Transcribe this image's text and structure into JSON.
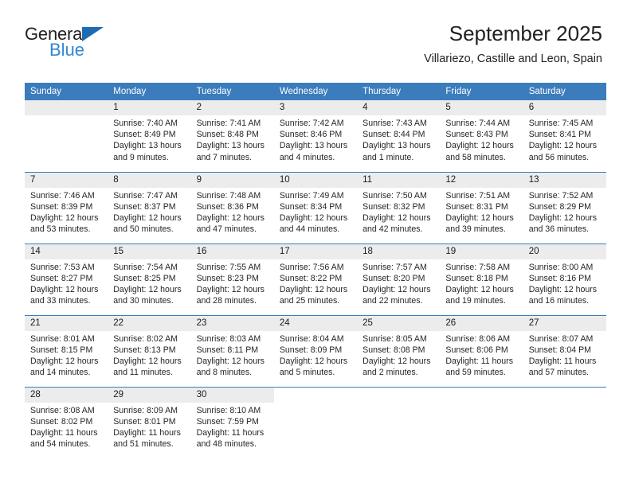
{
  "brand": {
    "name_top": "General",
    "name_bottom": "Blue",
    "accent_color": "#2f88d4",
    "triangle_color": "#1b6cb5"
  },
  "header": {
    "title": "September 2025",
    "subtitle": "Villariezo, Castille and Leon, Spain",
    "header_bg": "#3b7cbd",
    "daynum_bg": "#ececec"
  },
  "weekday_headers": [
    "Sunday",
    "Monday",
    "Tuesday",
    "Wednesday",
    "Thursday",
    "Friday",
    "Saturday"
  ],
  "weeks": [
    [
      {
        "day": "",
        "lines": []
      },
      {
        "day": "1",
        "lines": [
          "Sunrise: 7:40 AM",
          "Sunset: 8:49 PM",
          "Daylight: 13 hours",
          "and 9 minutes."
        ]
      },
      {
        "day": "2",
        "lines": [
          "Sunrise: 7:41 AM",
          "Sunset: 8:48 PM",
          "Daylight: 13 hours",
          "and 7 minutes."
        ]
      },
      {
        "day": "3",
        "lines": [
          "Sunrise: 7:42 AM",
          "Sunset: 8:46 PM",
          "Daylight: 13 hours",
          "and 4 minutes."
        ]
      },
      {
        "day": "4",
        "lines": [
          "Sunrise: 7:43 AM",
          "Sunset: 8:44 PM",
          "Daylight: 13 hours",
          "and 1 minute."
        ]
      },
      {
        "day": "5",
        "lines": [
          "Sunrise: 7:44 AM",
          "Sunset: 8:43 PM",
          "Daylight: 12 hours",
          "and 58 minutes."
        ]
      },
      {
        "day": "6",
        "lines": [
          "Sunrise: 7:45 AM",
          "Sunset: 8:41 PM",
          "Daylight: 12 hours",
          "and 56 minutes."
        ]
      }
    ],
    [
      {
        "day": "7",
        "lines": [
          "Sunrise: 7:46 AM",
          "Sunset: 8:39 PM",
          "Daylight: 12 hours",
          "and 53 minutes."
        ]
      },
      {
        "day": "8",
        "lines": [
          "Sunrise: 7:47 AM",
          "Sunset: 8:37 PM",
          "Daylight: 12 hours",
          "and 50 minutes."
        ]
      },
      {
        "day": "9",
        "lines": [
          "Sunrise: 7:48 AM",
          "Sunset: 8:36 PM",
          "Daylight: 12 hours",
          "and 47 minutes."
        ]
      },
      {
        "day": "10",
        "lines": [
          "Sunrise: 7:49 AM",
          "Sunset: 8:34 PM",
          "Daylight: 12 hours",
          "and 44 minutes."
        ]
      },
      {
        "day": "11",
        "lines": [
          "Sunrise: 7:50 AM",
          "Sunset: 8:32 PM",
          "Daylight: 12 hours",
          "and 42 minutes."
        ]
      },
      {
        "day": "12",
        "lines": [
          "Sunrise: 7:51 AM",
          "Sunset: 8:31 PM",
          "Daylight: 12 hours",
          "and 39 minutes."
        ]
      },
      {
        "day": "13",
        "lines": [
          "Sunrise: 7:52 AM",
          "Sunset: 8:29 PM",
          "Daylight: 12 hours",
          "and 36 minutes."
        ]
      }
    ],
    [
      {
        "day": "14",
        "lines": [
          "Sunrise: 7:53 AM",
          "Sunset: 8:27 PM",
          "Daylight: 12 hours",
          "and 33 minutes."
        ]
      },
      {
        "day": "15",
        "lines": [
          "Sunrise: 7:54 AM",
          "Sunset: 8:25 PM",
          "Daylight: 12 hours",
          "and 30 minutes."
        ]
      },
      {
        "day": "16",
        "lines": [
          "Sunrise: 7:55 AM",
          "Sunset: 8:23 PM",
          "Daylight: 12 hours",
          "and 28 minutes."
        ]
      },
      {
        "day": "17",
        "lines": [
          "Sunrise: 7:56 AM",
          "Sunset: 8:22 PM",
          "Daylight: 12 hours",
          "and 25 minutes."
        ]
      },
      {
        "day": "18",
        "lines": [
          "Sunrise: 7:57 AM",
          "Sunset: 8:20 PM",
          "Daylight: 12 hours",
          "and 22 minutes."
        ]
      },
      {
        "day": "19",
        "lines": [
          "Sunrise: 7:58 AM",
          "Sunset: 8:18 PM",
          "Daylight: 12 hours",
          "and 19 minutes."
        ]
      },
      {
        "day": "20",
        "lines": [
          "Sunrise: 8:00 AM",
          "Sunset: 8:16 PM",
          "Daylight: 12 hours",
          "and 16 minutes."
        ]
      }
    ],
    [
      {
        "day": "21",
        "lines": [
          "Sunrise: 8:01 AM",
          "Sunset: 8:15 PM",
          "Daylight: 12 hours",
          "and 14 minutes."
        ]
      },
      {
        "day": "22",
        "lines": [
          "Sunrise: 8:02 AM",
          "Sunset: 8:13 PM",
          "Daylight: 12 hours",
          "and 11 minutes."
        ]
      },
      {
        "day": "23",
        "lines": [
          "Sunrise: 8:03 AM",
          "Sunset: 8:11 PM",
          "Daylight: 12 hours",
          "and 8 minutes."
        ]
      },
      {
        "day": "24",
        "lines": [
          "Sunrise: 8:04 AM",
          "Sunset: 8:09 PM",
          "Daylight: 12 hours",
          "and 5 minutes."
        ]
      },
      {
        "day": "25",
        "lines": [
          "Sunrise: 8:05 AM",
          "Sunset: 8:08 PM",
          "Daylight: 12 hours",
          "and 2 minutes."
        ]
      },
      {
        "day": "26",
        "lines": [
          "Sunrise: 8:06 AM",
          "Sunset: 8:06 PM",
          "Daylight: 11 hours",
          "and 59 minutes."
        ]
      },
      {
        "day": "27",
        "lines": [
          "Sunrise: 8:07 AM",
          "Sunset: 8:04 PM",
          "Daylight: 11 hours",
          "and 57 minutes."
        ]
      }
    ],
    [
      {
        "day": "28",
        "lines": [
          "Sunrise: 8:08 AM",
          "Sunset: 8:02 PM",
          "Daylight: 11 hours",
          "and 54 minutes."
        ]
      },
      {
        "day": "29",
        "lines": [
          "Sunrise: 8:09 AM",
          "Sunset: 8:01 PM",
          "Daylight: 11 hours",
          "and 51 minutes."
        ]
      },
      {
        "day": "30",
        "lines": [
          "Sunrise: 8:10 AM",
          "Sunset: 7:59 PM",
          "Daylight: 11 hours",
          "and 48 minutes."
        ]
      },
      {
        "day": "",
        "lines": []
      },
      {
        "day": "",
        "lines": []
      },
      {
        "day": "",
        "lines": []
      },
      {
        "day": "",
        "lines": []
      }
    ]
  ]
}
